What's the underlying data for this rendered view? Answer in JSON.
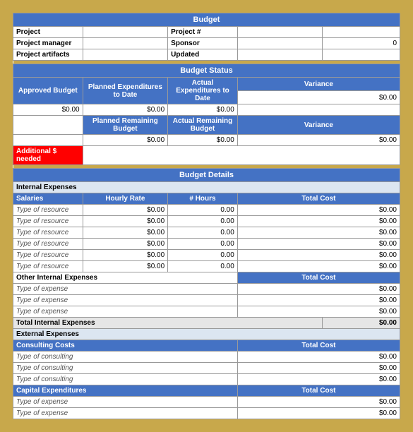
{
  "budget": {
    "title": "Budget",
    "project_label": "Project",
    "project_num_label": "Project #",
    "project_num_value": "",
    "project_manager_label": "Project manager",
    "sponsor_label": "Sponsor",
    "sponsor_value": "0",
    "project_artifacts_label": "Project artifacts",
    "updated_label": "Updated",
    "updated_value": ""
  },
  "budget_status": {
    "title": "Budget Status",
    "approved_budget_label": "Approved Budget",
    "planned_exp_label": "Planned Expenditures to Date",
    "actual_exp_label": "Actual Expenditures to Date",
    "variance_label": "Variance",
    "approved_value": "$0.00",
    "planned_value": "$0.00",
    "actual_value": "$0.00",
    "variance_value": "$0.00",
    "planned_remaining_label": "Planned Remaining Budget",
    "actual_remaining_label": "Actual Remaining Budget",
    "variance_label2": "Variance",
    "planned_remaining_value": "$0.00",
    "actual_remaining_value": "$0.00",
    "variance_value2": "$0.00",
    "additional_needed_label": "Additional $ needed"
  },
  "budget_details": {
    "title": "Budget Details",
    "internal_expenses_label": "Internal Expenses",
    "salaries_label": "Salaries",
    "hourly_rate_label": "Hourly Rate",
    "hours_label": "# Hours",
    "total_cost_label": "Total Cost",
    "resources": [
      {
        "name": "Type of resource",
        "rate": "$0.00",
        "hours": "0.00",
        "cost": "$0.00"
      },
      {
        "name": "Type of resource",
        "rate": "$0.00",
        "hours": "0.00",
        "cost": "$0.00"
      },
      {
        "name": "Type of resource",
        "rate": "$0.00",
        "hours": "0.00",
        "cost": "$0.00"
      },
      {
        "name": "Type of resource",
        "rate": "$0.00",
        "hours": "0.00",
        "cost": "$0.00"
      },
      {
        "name": "Type of resource",
        "rate": "$0.00",
        "hours": "0.00",
        "cost": "$0.00"
      },
      {
        "name": "Type of resource",
        "rate": "$0.00",
        "hours": "0.00",
        "cost": "$0.00"
      }
    ],
    "other_internal_label": "Other Internal Expenses",
    "total_cost_label2": "Total Cost",
    "expenses": [
      {
        "name": "Type of expense",
        "cost": "$0.00"
      },
      {
        "name": "Type of expense",
        "cost": "$0.00"
      },
      {
        "name": "Type of expense",
        "cost": "$0.00"
      }
    ],
    "total_internal_label": "Total Internal Expenses",
    "total_internal_value": "$0.00",
    "external_expenses_label": "External Expenses",
    "consulting_label": "Consulting Costs",
    "total_cost_label3": "Total Cost",
    "consulting": [
      {
        "name": "Type of consulting",
        "cost": "$0.00"
      },
      {
        "name": "Type of consulting",
        "cost": "$0.00"
      },
      {
        "name": "Type of consulting",
        "cost": "$0.00"
      }
    ],
    "capital_label": "Capital Expenditures",
    "total_cost_label4": "Total Cost",
    "capital": [
      {
        "name": "Type of expense",
        "cost": "$0.00"
      },
      {
        "name": "Type of expense",
        "cost": "$0.00"
      }
    ]
  }
}
